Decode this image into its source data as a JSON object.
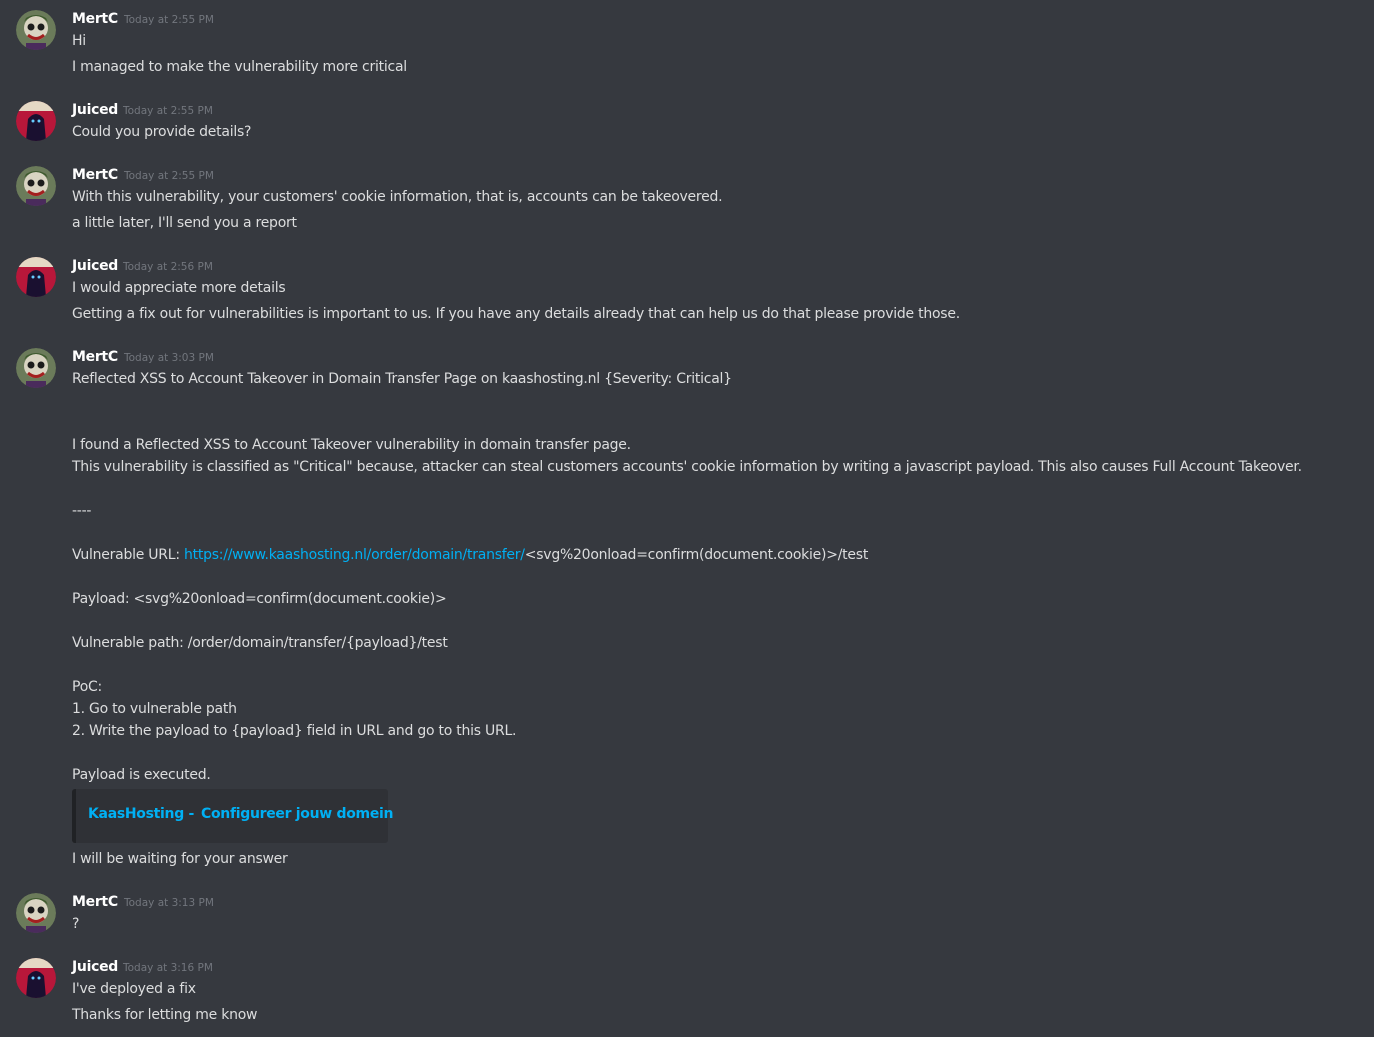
{
  "colors": {
    "background": "#36393f",
    "link": "#00b0f4",
    "embed_bg": "#2f3136",
    "timestamp": "#72767d"
  },
  "messages": [
    {
      "author": "MertC",
      "avatar_icon": "joker-avatar-icon",
      "timestamp": "Today at 2:55 PM",
      "lines": [
        "Hi",
        "I managed to make the vulnerability more critical"
      ]
    },
    {
      "author": "Juiced",
      "avatar_icon": "dark-figure-avatar-icon",
      "timestamp": "Today at 2:55 PM",
      "lines": [
        "Could you provide details?"
      ]
    },
    {
      "author": "MertC",
      "avatar_icon": "joker-avatar-icon",
      "timestamp": "Today at 2:55 PM",
      "lines": [
        "With this vulnerability, your customers' cookie information, that is, accounts can be takeovered.",
        "a little later, I'll send you a report"
      ]
    },
    {
      "author": "Juiced",
      "avatar_icon": "dark-figure-avatar-icon",
      "timestamp": "Today at 2:56 PM",
      "lines": [
        "I would appreciate more details",
        "Getting a fix out for vulnerabilities is important to us. If you have any details already that can help us do that please provide those."
      ]
    },
    {
      "author": "MertC",
      "avatar_icon": "joker-avatar-icon",
      "timestamp": "Today at 3:03 PM",
      "report": {
        "title": "Reflected XSS to Account Takeover in Domain Transfer Page on kaashosting.nl {Severity: Critical}",
        "intro1": "I found a Reflected XSS to Account Takeover vulnerability in domain transfer page.",
        "intro2": "This vulnerability is classified as \"Critical\" because, attacker can steal customers accounts' cookie information by writing a javascript payload. This also causes Full Account Takeover.",
        "separator": "----",
        "url_label": "Vulnerable URL: ",
        "url_link": "https://www.kaashosting.nl/order/domain/transfer/",
        "url_rest": "<svg%20onload=confirm(document.cookie)>/test",
        "payload": "Payload: <svg%20onload=confirm(document.cookie)>",
        "path": "Vulnerable path: /order/domain/transfer/{payload}/test",
        "poc_title": "PoC:",
        "poc_step1": "1. Go to vulnerable path",
        "poc_step2": "2. Write the payload to {payload} field in URL and go to this URL.",
        "executed": "Payload is executed.",
        "embed_site": "KaasHosting -",
        "embed_title": "Configureer jouw domein",
        "closing": "I will be waiting for your answer"
      }
    },
    {
      "author": "MertC",
      "avatar_icon": "joker-avatar-icon",
      "timestamp": "Today at 3:13 PM",
      "lines": [
        "?"
      ]
    },
    {
      "author": "Juiced",
      "avatar_icon": "dark-figure-avatar-icon",
      "timestamp": "Today at 3:16 PM",
      "lines": [
        "I've deployed a fix",
        "Thanks for letting me know"
      ]
    }
  ]
}
